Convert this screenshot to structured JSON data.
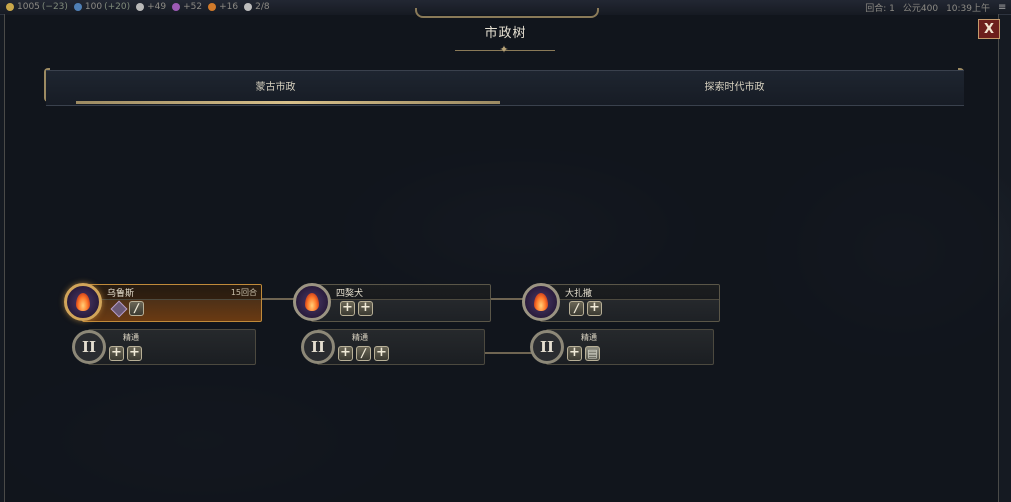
{
  "topbar": {
    "resources": [
      {
        "name": "gold",
        "value": "1005",
        "bonus": "(−23)",
        "color": "#c9a74a"
      },
      {
        "name": "science",
        "value": "100",
        "bonus": "(+20)",
        "color": "#4f7fb5"
      },
      {
        "name": "faith",
        "value": "+49",
        "bonus": "",
        "color": "#b9b9b9"
      },
      {
        "name": "culture",
        "value": "+52",
        "bonus": "",
        "color": "#9d5ab5"
      },
      {
        "name": "happiness",
        "value": "+16",
        "bonus": "",
        "color": "#d17a2a"
      },
      {
        "name": "population",
        "value": "2/8",
        "bonus": "",
        "color": "#bdbdbd"
      }
    ],
    "turn": "回合: 1",
    "era": "公元400",
    "clock": "10:39上午"
  },
  "panel": {
    "title": "市政树",
    "close_label": "X"
  },
  "tabs": [
    {
      "label": "蒙古市政",
      "active": true
    },
    {
      "label": "探索时代市政",
      "active": false
    }
  ],
  "civics": [
    {
      "name": "乌鲁斯",
      "turns": "15回合",
      "active": true,
      "perks": [
        "diamond",
        "slash"
      ],
      "upgrade": {
        "label": "精通",
        "roman": "II",
        "perks": [
          "plus",
          "plus"
        ]
      }
    },
    {
      "name": "四獒犬",
      "turns": "",
      "active": false,
      "perks": [
        "plus",
        "plus"
      ],
      "upgrade": {
        "label": "精通",
        "roman": "II",
        "perks": [
          "plus",
          "slash",
          "plus"
        ]
      }
    },
    {
      "name": "大扎撒",
      "turns": "",
      "active": false,
      "perks": [
        "slash",
        "plus"
      ],
      "upgrade": {
        "label": "精通",
        "roman": "II",
        "perks": [
          "plus",
          "scroll"
        ]
      }
    }
  ],
  "icons": {
    "civic": "flame-icon",
    "mastery": "roman-numeral-icon",
    "perk_plus": "plus-icon",
    "perk_slash": "sword-icon",
    "perk_diamond": "diamond-icon",
    "perk_scroll": "scroll-icon"
  }
}
